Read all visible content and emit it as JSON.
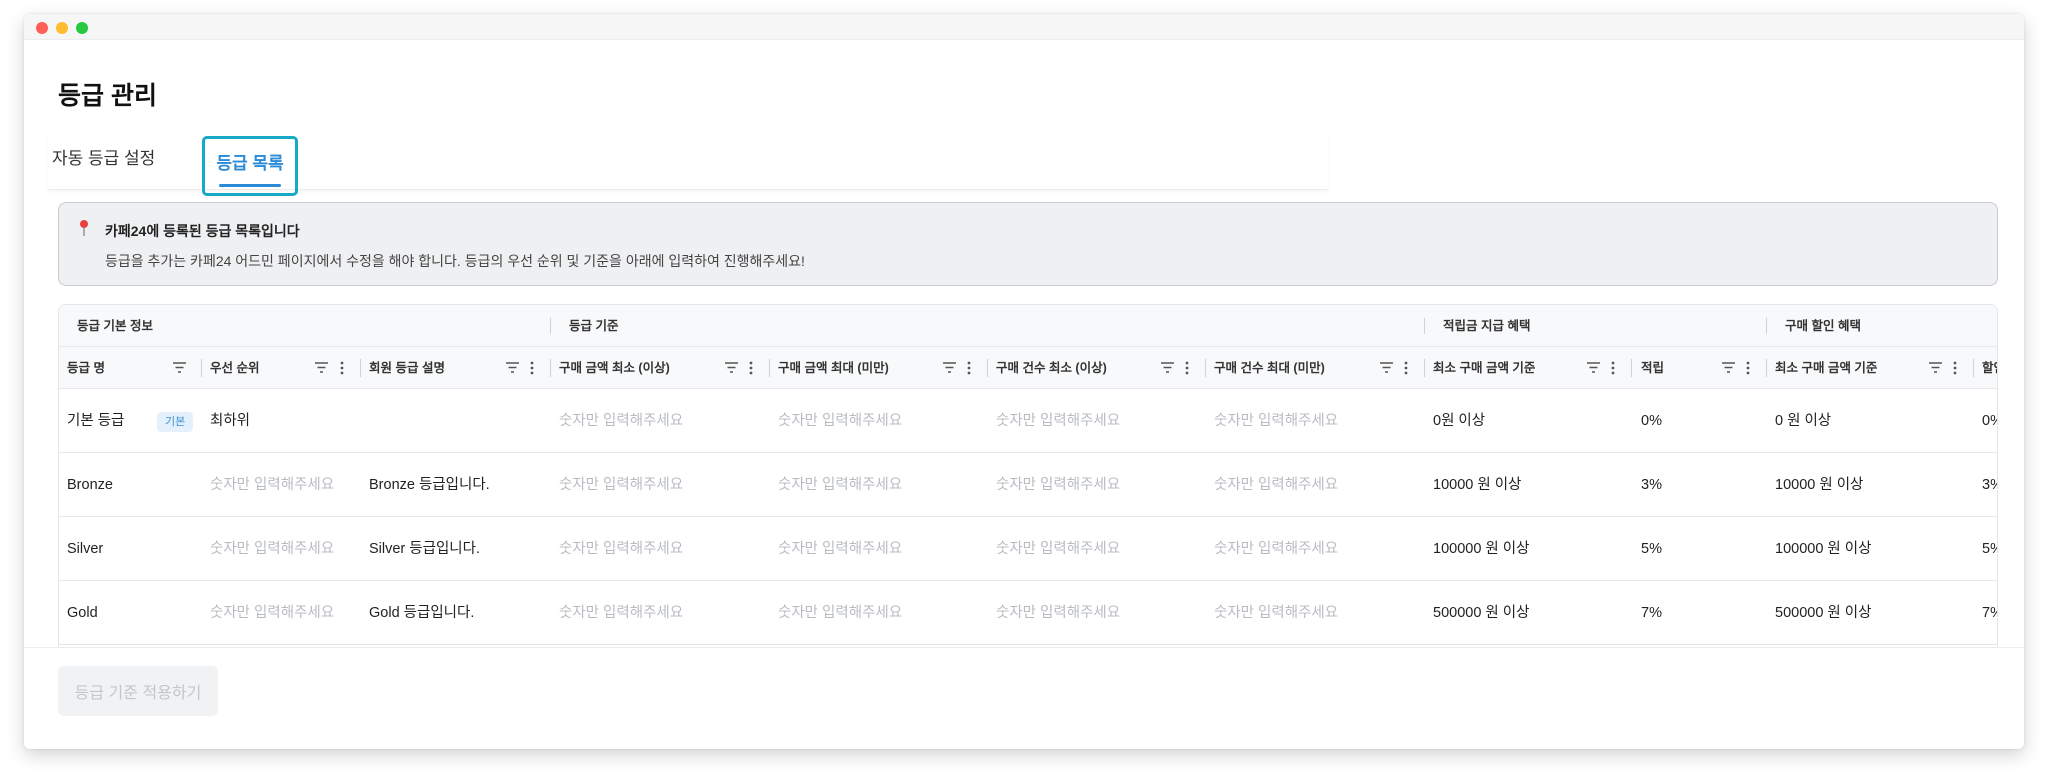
{
  "page": {
    "title": "등급 관리",
    "tabs": [
      {
        "label": "자동 등급 설정",
        "active": false
      },
      {
        "label": "등급 목록",
        "active": true
      }
    ]
  },
  "notice": {
    "icon": "pin-icon",
    "title": "카페24에 등록된 등급 목록입니다",
    "description": "등급을 추가는 카페24 어드민 페이지에서 수정을 해야 합니다. 등급의 우선 순위 및 기준을 아래에 입력하여 진행해주세요!"
  },
  "table": {
    "groups": [
      "등급 기본 정보",
      "등급 기준",
      "적립금 지급 혜택",
      "구매 할인 혜택"
    ],
    "columns": [
      "등급 명",
      "우선 순위",
      "회원 등급 설명",
      "구매 금액 최소 (이상)",
      "구매 금액 최대 (미만)",
      "구매 건수 최소 (이상)",
      "구매 건수 최대 (미만)",
      "최소 구매 금액 기준",
      "적립",
      "최소 구매 금액 기준",
      "할인"
    ],
    "placeholder": "숫자만 입력해주세요",
    "default_badge": "기본",
    "rows": [
      {
        "name": "기본 등급",
        "priority": "최하위",
        "description": "",
        "min_buy_amount": "",
        "max_buy_amount": "",
        "min_buy_count": "",
        "max_buy_count": "",
        "reward_min": "0원 이상",
        "reward_rate": "0%",
        "discount_min": "0 원 이상",
        "discount_rate": "0%"
      },
      {
        "name": "Bronze",
        "priority": "",
        "description": "Bronze 등급입니다.",
        "min_buy_amount": "",
        "max_buy_amount": "",
        "min_buy_count": "",
        "max_buy_count": "",
        "reward_min": "10000 원 이상",
        "reward_rate": "3%",
        "discount_min": "10000 원 이상",
        "discount_rate": "3%"
      },
      {
        "name": "Silver",
        "priority": "",
        "description": "Silver 등급입니다.",
        "min_buy_amount": "",
        "max_buy_amount": "",
        "min_buy_count": "",
        "max_buy_count": "",
        "reward_min": "100000 원 이상",
        "reward_rate": "5%",
        "discount_min": "100000 원 이상",
        "discount_rate": "5%"
      },
      {
        "name": "Gold",
        "priority": "",
        "description": "Gold 등급입니다.",
        "min_buy_amount": "",
        "max_buy_amount": "",
        "min_buy_count": "",
        "max_buy_count": "",
        "reward_min": "500000 원 이상",
        "reward_rate": "7%",
        "discount_min": "500000 원 이상",
        "discount_rate": "7%"
      }
    ]
  },
  "footer": {
    "apply_label": "등급 기준 적용하기"
  },
  "colors": {
    "accent": "#2a8bd8",
    "tab_highlight": "#16a9c8",
    "placeholder": "#b8bcc2"
  }
}
